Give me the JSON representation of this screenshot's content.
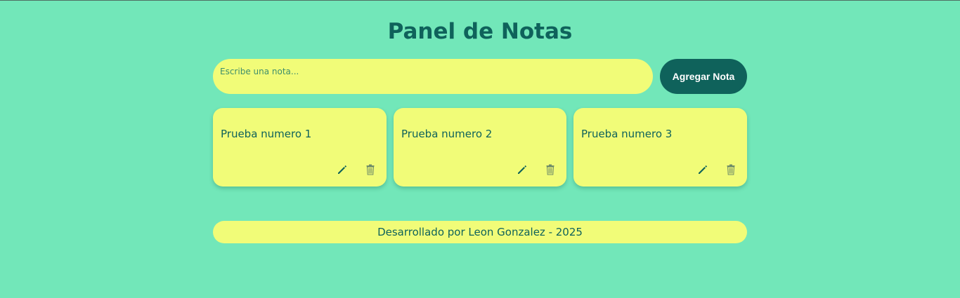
{
  "header": {
    "title": "Panel de Notas"
  },
  "input": {
    "placeholder": "Escribe una nota...",
    "value": ""
  },
  "add_button": {
    "label": "Agregar Nota"
  },
  "notes": [
    {
      "text": "Prueba numero 1",
      "edit_icon": "pencil-icon",
      "delete_icon": "trash-icon"
    },
    {
      "text": "Prueba numero 2",
      "edit_icon": "pencil-icon",
      "delete_icon": "trash-icon"
    },
    {
      "text": "Prueba numero 3",
      "edit_icon": "pencil-icon",
      "delete_icon": "trash-icon"
    }
  ],
  "footer": {
    "text": "Desarrollado por Leon Gonzalez - 2025"
  },
  "colors": {
    "background": "#72e7b9",
    "accent": "#0f625b",
    "note": "#f1fc78"
  }
}
